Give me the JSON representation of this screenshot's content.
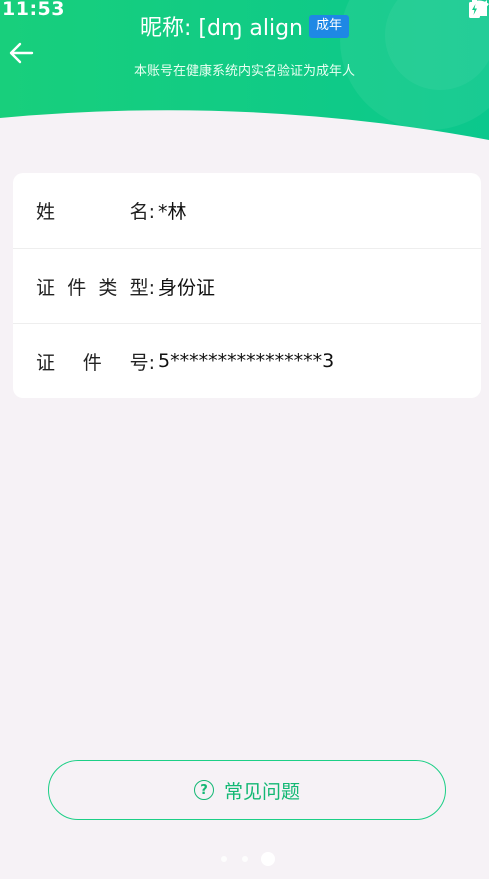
{
  "status_bar": {
    "time": "11:53",
    "icons": [
      "wifi-icon",
      "signal-icon",
      "battery-icon"
    ]
  },
  "header": {
    "back_icon": "arrow-left-icon",
    "nickname_label": "昵称: [dɱ align",
    "badge": "成年",
    "subtitle": "本账号在健康系统内实名验证为成年人",
    "colors": {
      "gradient_start": "#1dd47f",
      "gradient_end": "#06c58b",
      "badge": "#1e88e5"
    }
  },
  "info": {
    "rows": [
      {
        "label_chars": [
          "姓",
          "名:"
        ],
        "value": "*林"
      },
      {
        "label_chars": [
          "证",
          "件",
          "类",
          "型:"
        ],
        "value": "身份证"
      },
      {
        "label_chars": [
          "证",
          "件",
          "号:"
        ],
        "value": "5****************3"
      }
    ]
  },
  "faq": {
    "icon": "question-circle-icon",
    "icon_glyph": "?",
    "label": "常见问题",
    "color": "#13b874"
  },
  "pager": {
    "count": 3,
    "active_index": 2
  }
}
